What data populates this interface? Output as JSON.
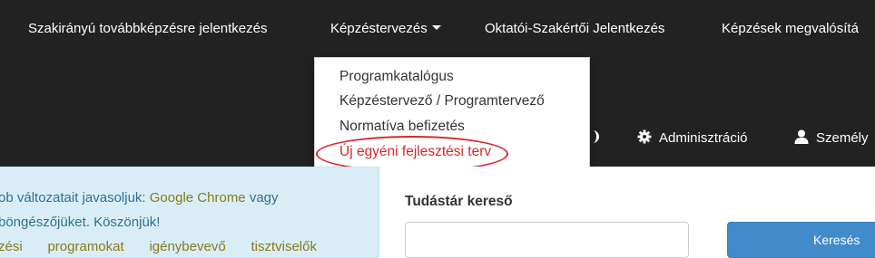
{
  "nav": {
    "items": [
      {
        "label": "Szakirányú továbbképzésre jelentkezés"
      },
      {
        "label": "Képzéstervezés"
      },
      {
        "label": "Oktatói-Szakértői Jelentkezés"
      },
      {
        "label": "Képzések megvalósítá"
      }
    ],
    "dropdown": [
      {
        "label": "Programkatalógus"
      },
      {
        "label": "Képzéstervező / Programtervező"
      },
      {
        "label": "Normatíva befizetés"
      },
      {
        "label": "Új egyéni fejlesztési terv"
      }
    ],
    "secondary": [
      {
        "label": "Adminisztráció",
        "icon": "gear-icon"
      },
      {
        "label": "Személy",
        "icon": "user-icon"
      }
    ]
  },
  "notice": {
    "line1_prefix": "ob változatait javasoljuk: ",
    "line1_link": "Google Chrome",
    "line1_suffix": " vagy",
    "line2": "böngészőjüket. Köszönjük!",
    "line3_words": [
      "zési",
      "programokat",
      "igénybevevő",
      "tisztviselők"
    ]
  },
  "search": {
    "title": "Tudástár kereső",
    "input_value": "",
    "button_label": "Keresés"
  },
  "colors": {
    "navbar_bg": "#222222",
    "highlight_red": "#d9262c",
    "notice_bg": "#d9edf7",
    "notice_text": "#31708f",
    "button_blue": "#428bca"
  }
}
